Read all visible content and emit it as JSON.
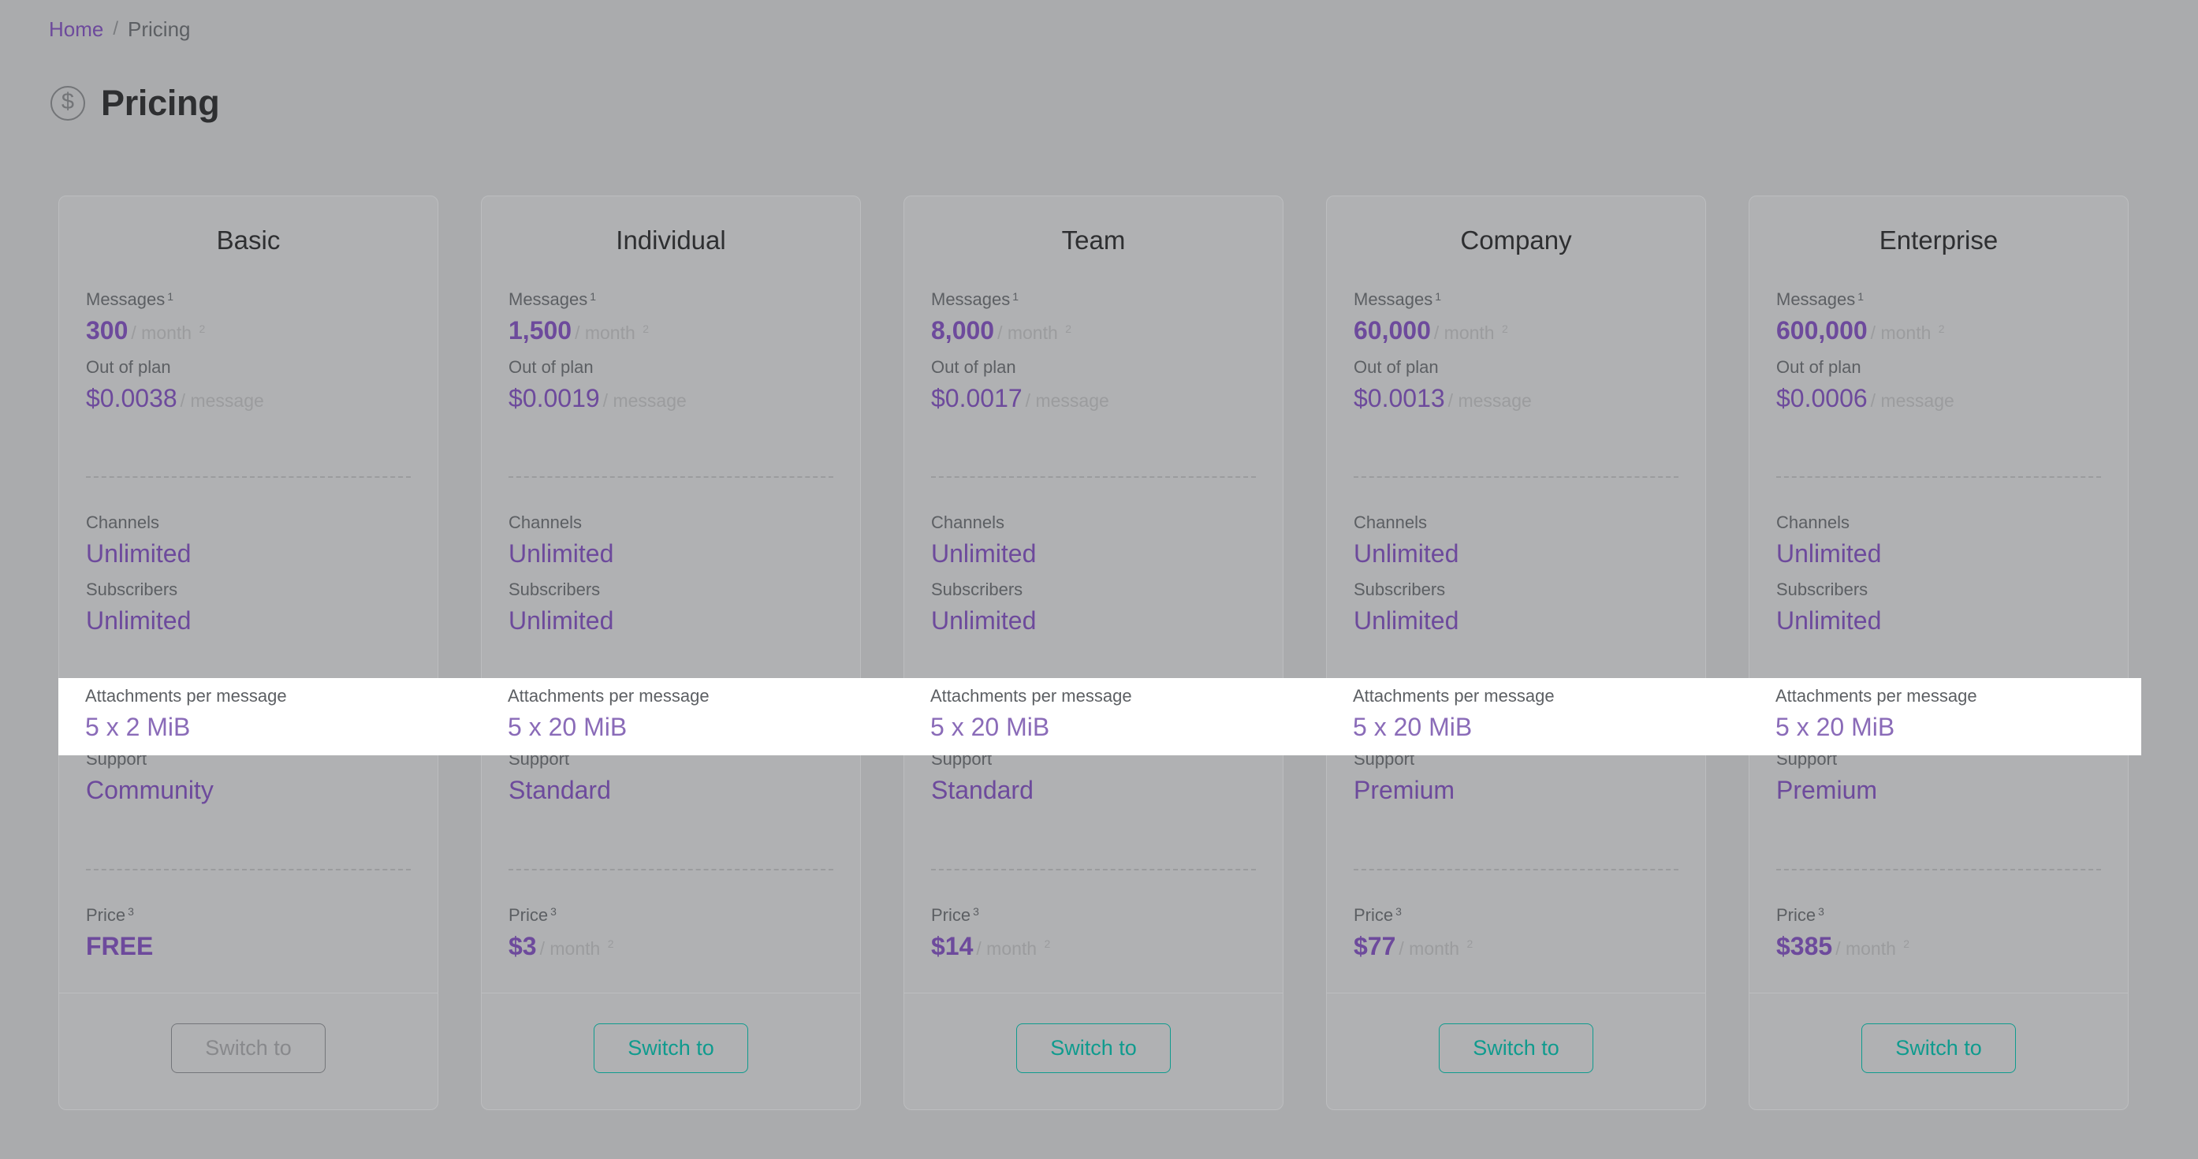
{
  "breadcrumb": {
    "home": "Home",
    "separator": "/",
    "current": "Pricing"
  },
  "header": {
    "title": "Pricing",
    "icon": "dollar-circle-icon"
  },
  "labels": {
    "messages": "Messages",
    "messages_sup": "1",
    "out_of_plan": "Out of plan",
    "channels": "Channels",
    "subscribers": "Subscribers",
    "attachments": "Attachments per message",
    "support": "Support",
    "price": "Price",
    "price_sup": "3",
    "per_month": "/ month",
    "per_month_sup": "2",
    "per_message": "/ message"
  },
  "colors": {
    "accent_purple": "#6d4a9c",
    "accent_teal": "#0f9b8e",
    "page_background": "#aaabad",
    "card_background": "#b0b1b3",
    "highlight_background": "#ffffff"
  },
  "highlight_row": "attachments",
  "plans": [
    {
      "name": "Basic",
      "messages": "300",
      "out_of_plan": "$0.0038",
      "channels": "Unlimited",
      "subscribers": "Unlimited",
      "attachments": "5 x 2 MiB",
      "support": "Community",
      "price": "FREE",
      "price_has_unit": false,
      "button_label": "Switch to",
      "button_disabled": true
    },
    {
      "name": "Individual",
      "messages": "1,500",
      "out_of_plan": "$0.0019",
      "channels": "Unlimited",
      "subscribers": "Unlimited",
      "attachments": "5 x 20 MiB",
      "support": "Standard",
      "price": "$3",
      "price_has_unit": true,
      "button_label": "Switch to",
      "button_disabled": false
    },
    {
      "name": "Team",
      "messages": "8,000",
      "out_of_plan": "$0.0017",
      "channels": "Unlimited",
      "subscribers": "Unlimited",
      "attachments": "5 x 20 MiB",
      "support": "Standard",
      "price": "$14",
      "price_has_unit": true,
      "button_label": "Switch to",
      "button_disabled": false
    },
    {
      "name": "Company",
      "messages": "60,000",
      "out_of_plan": "$0.0013",
      "channels": "Unlimited",
      "subscribers": "Unlimited",
      "attachments": "5 x 20 MiB",
      "support": "Premium",
      "price": "$77",
      "price_has_unit": true,
      "button_label": "Switch to",
      "button_disabled": false
    },
    {
      "name": "Enterprise",
      "messages": "600,000",
      "out_of_plan": "$0.0006",
      "channels": "Unlimited",
      "subscribers": "Unlimited",
      "attachments": "5 x 20 MiB",
      "support": "Premium",
      "price": "$385",
      "price_has_unit": true,
      "button_label": "Switch to",
      "button_disabled": false
    }
  ]
}
